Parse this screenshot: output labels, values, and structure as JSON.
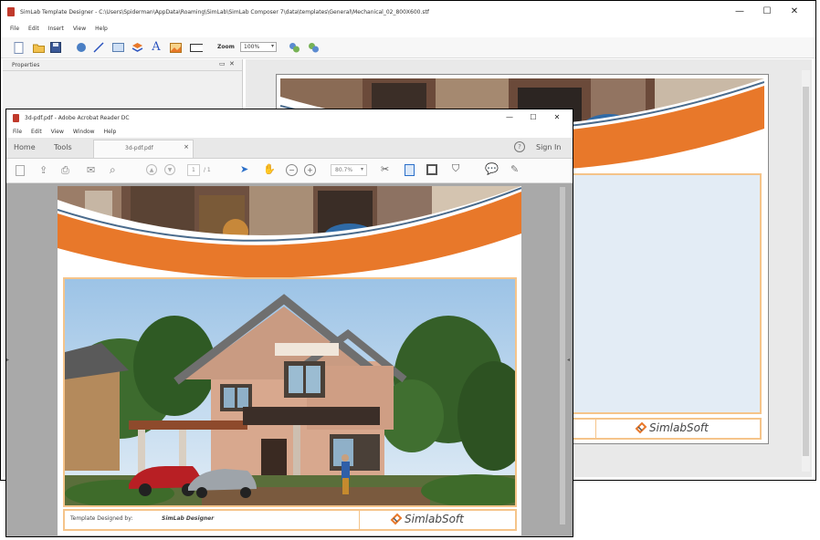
{
  "designer": {
    "title": "SimLab Template Designer - C:\\Users\\Spiderman\\AppData\\Roaming\\SimLab\\SimLab Composer 7\\data\\templates\\General\\Mechanical_02_800X600.stf",
    "menu": [
      "File",
      "Edit",
      "Insert",
      "View",
      "Help"
    ],
    "zoom_label": "Zoom",
    "zoom_value": "100%",
    "properties_label": "Properties",
    "footer_logo": "SimlabSoft"
  },
  "reader": {
    "title": "3d-pdf.pdf - Adobe Acrobat Reader DC",
    "menu": [
      "File",
      "Edit",
      "View",
      "Window",
      "Help"
    ],
    "tabs": {
      "home": "Home",
      "tools": "Tools",
      "doc": "3d-pdf.pdf"
    },
    "sign_in": "Sign In",
    "page_current": "1",
    "page_total": "/ 1",
    "zoom": "80.7%",
    "footer_caption_prefix": "Template Designed by:",
    "footer_caption_brand": "SimLab Designer",
    "footer_logo": "SimlabSoft"
  },
  "colors": {
    "accent_orange": "#e8782a",
    "frame_border": "#f5c48a",
    "sky": "#b9d3ea",
    "panel_gray": "#f0f0f0"
  }
}
